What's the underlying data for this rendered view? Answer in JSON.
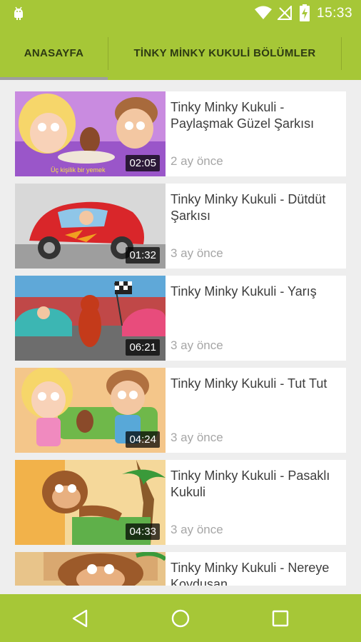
{
  "status_bar": {
    "time": "15:33"
  },
  "tabs": [
    {
      "label": "ANASAYFA",
      "selected": true
    },
    {
      "label": "TİNKY MİNKY KUKULİ BÖLÜMLER",
      "selected": false
    }
  ],
  "videos": [
    {
      "title": "Tinky Minky Kukuli - Paylaşmak Güzel Şarkısı",
      "duration": "02:05",
      "age": "2 ay önce"
    },
    {
      "title": "Tinky Minky Kukuli - Dütdüt Şarkısı",
      "duration": "01:32",
      "age": "3 ay önce"
    },
    {
      "title": "Tinky Minky Kukuli - Yarış",
      "duration": "06:21",
      "age": "3 ay önce"
    },
    {
      "title": "Tinky Minky Kukuli - Tut Tut",
      "duration": "04:24",
      "age": "3 ay önce"
    },
    {
      "title": "Tinky Minky Kukuli - Pasaklı Kukuli",
      "duration": "04:33",
      "age": "3 ay önce"
    },
    {
      "title": "Tinky Minky Kukuli - Nereye Koydusan",
      "duration": "",
      "age": ""
    }
  ],
  "nav": {
    "back_icon": "back-icon",
    "home_icon": "home-icon",
    "recents_icon": "recents-icon"
  },
  "colors": {
    "accent": "#a6c737",
    "tab_indicator": "#9e9e9e",
    "background": "#eeeeee"
  }
}
